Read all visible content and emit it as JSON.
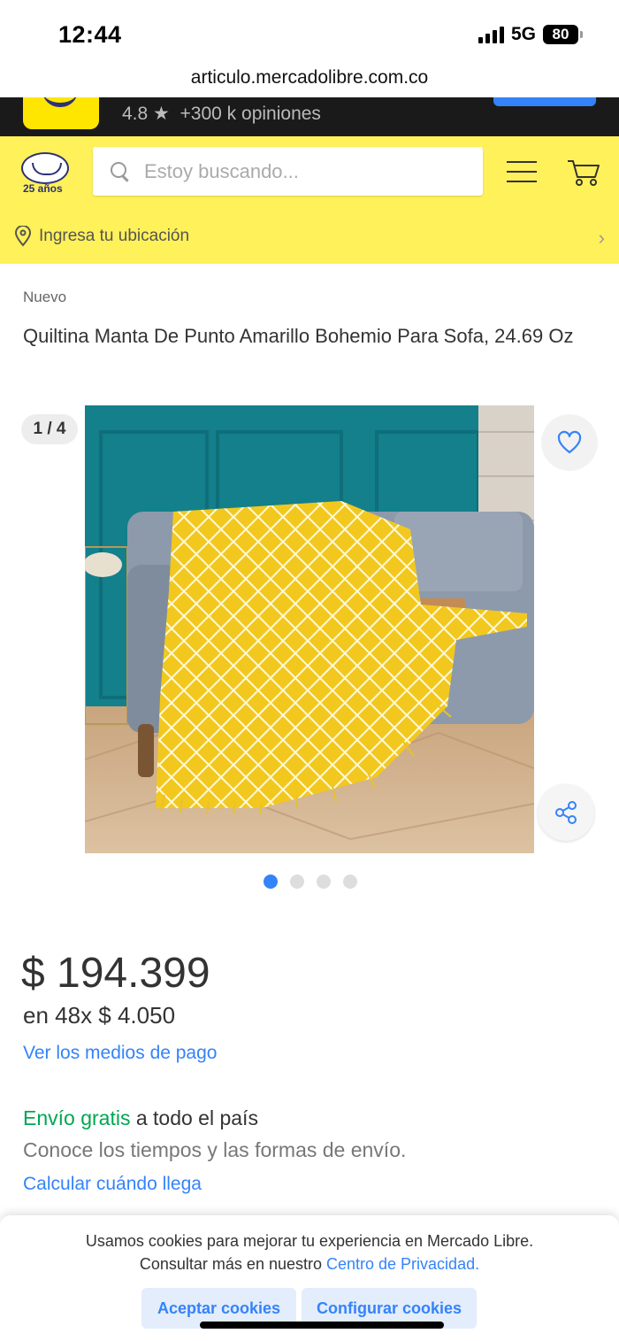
{
  "status_bar": {
    "time": "12:44",
    "network": "5G",
    "battery": "80"
  },
  "browser": {
    "url": "articulo.mercadolibre.com.co"
  },
  "app_banner": {
    "rating": "4.8",
    "reviews": "+300 k opiniones"
  },
  "header": {
    "logo_caption": "25 años",
    "search_placeholder": "Estoy buscando...",
    "location_label": "Ingresa tu ubicación"
  },
  "product": {
    "condition": "Nuevo",
    "title": "Quiltina Manta De Punto Amarillo Bohemio Para Sofa, 24.69 Oz",
    "gallery_counter": "1 / 4",
    "gallery_total": 4,
    "gallery_active": 0,
    "price": "$ 194.399",
    "installments": "en 48x $ 4.050",
    "payment_link": "Ver los medios de pago",
    "shipping_free": "Envío gratis",
    "shipping_rest": " a todo el país",
    "shipping_sub": "Conoce los tiempos y las formas de envío.",
    "calc_link": "Calcular cuándo llega"
  },
  "cookie_banner": {
    "line1": "Usamos cookies para mejorar tu experiencia en Mercado Libre.",
    "line2_prefix": "Consultar más en nuestro ",
    "line2_link": "Centro de Privacidad.",
    "accept_label": "Aceptar cookies",
    "configure_label": "Configurar cookies"
  },
  "colors": {
    "brand_yellow": "#fff159",
    "link_blue": "#3483fa",
    "free_green": "#00a650"
  }
}
